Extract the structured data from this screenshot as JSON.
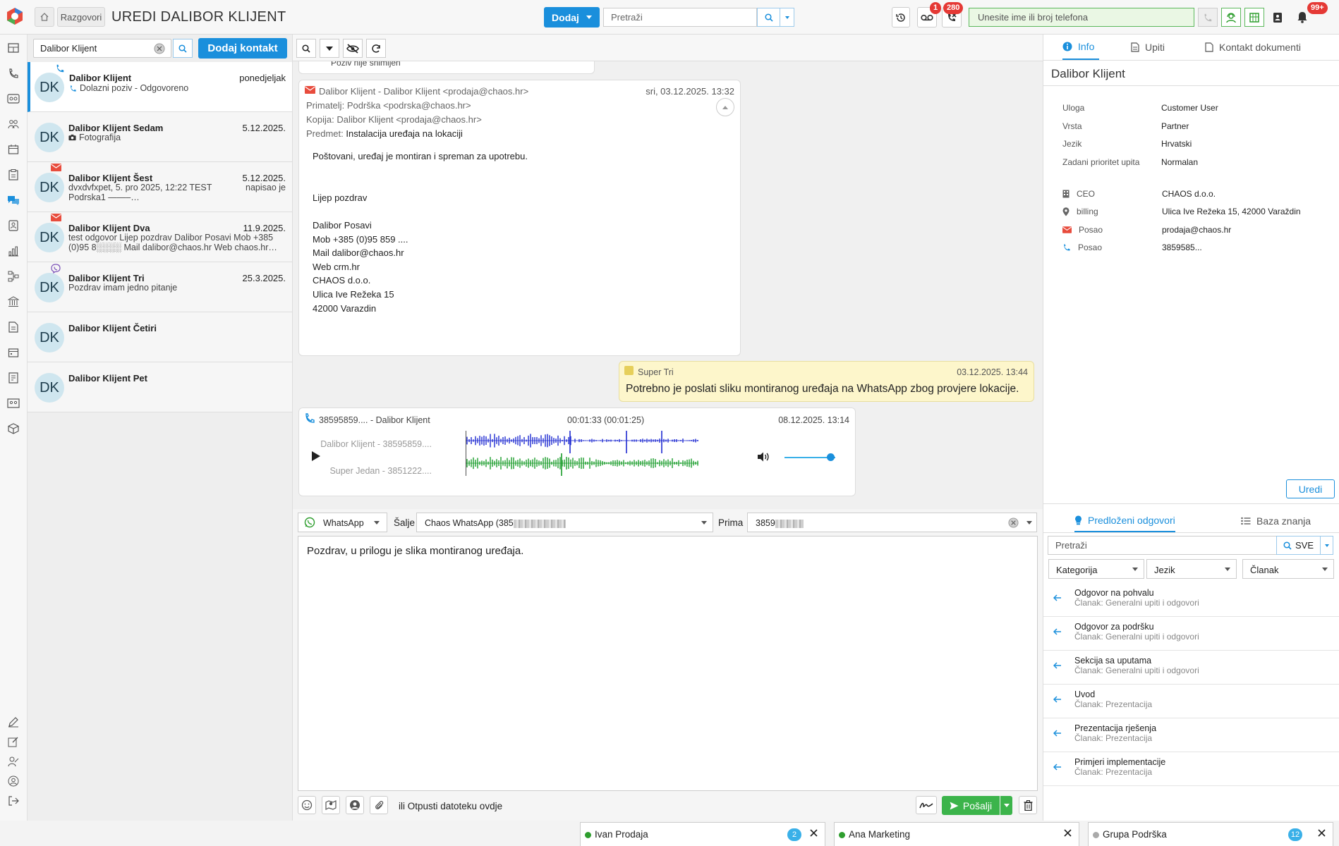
{
  "header": {
    "title": "UREDI DALIBOR KLIJENT",
    "breadcrumb": "Razgovori",
    "add_label": "Dodaj",
    "search_placeholder": "Pretraži",
    "voicemail_badge": "1",
    "missed_badge": "280",
    "phone_placeholder": "Unesite ime ili broj telefona",
    "notifications_badge": "99+"
  },
  "contacts": {
    "search_value": "Dalibor Klijent",
    "add_button": "Dodaj kontakt",
    "items": [
      {
        "initials": "DK",
        "name": "Dalibor Klijent",
        "date": "ponedjeljak",
        "sub": "Dolazni poziv - Odgovoreno",
        "badge": "phone-icon"
      },
      {
        "initials": "DK",
        "name": "Dalibor Klijent Sedam",
        "date": "5.12.2025.",
        "sub": "Fotografija",
        "badge": ""
      },
      {
        "initials": "DK",
        "name": "Dalibor Klijent Šest",
        "date": "5.12.2025.",
        "sub": "dvxdvfxpet, 5. pro 2025, 12:22 TEST Podrska1  ——–…",
        "extra": "napisao je",
        "badge": "email-icon"
      },
      {
        "initials": "DK",
        "name": "Dalibor Klijent Dva",
        "date": "11.9.2025.",
        "sub": "test odgovor Lijep pozdrav Dalibor Posavi Mob +385 (0)95 8░░░░ Mail dalibor@chaos.hr Web chaos.hr…",
        "badge": "email-icon"
      },
      {
        "initials": "DK",
        "name": "Dalibor Klijent Tri",
        "date": "25.3.2025.",
        "sub": "Pozdrav imam jedno pitanje",
        "badge": "viber-icon"
      },
      {
        "initials": "DK",
        "name": "Dalibor Klijent Četiri",
        "date": "",
        "sub": "",
        "badge": ""
      },
      {
        "initials": "DK",
        "name": "Dalibor Klijent Pet",
        "date": "",
        "sub": "",
        "badge": ""
      }
    ]
  },
  "chat": {
    "prev_message_tail": "Poziv nije snimljen",
    "email": {
      "from": "Dalibor Klijent - Dalibor Klijent <prodaja@chaos.hr>",
      "date": "sri, 03.12.2025. 13:32",
      "to_label": "Primatelj:",
      "to": "Podrška <podrska@chaos.hr>",
      "cc_label": "Kopija:",
      "cc": "Dalibor Klijent <prodaja@chaos.hr>",
      "subject_label": "Predmet:",
      "subject": "Instalacija uređaja na lokaciji",
      "body": "Poštovani, uređaj je montiran i spreman za upotrebu.\n\n\nLijep pozdrav\n\nDalibor Posavi\nMob +385 (0)95 859 ....\nMail dalibor@chaos.hr\nWeb crm.hr\nCHAOS d.o.o.\nUlica Ive Režeka 15\n42000 Varazdin"
    },
    "note": {
      "author": "Super Tri",
      "date": "03.12.2025. 13:44",
      "text": "Potrebno je poslati sliku montiranog uređaja na WhatsApp zbog provjere lokacije."
    },
    "call": {
      "title": "38595859.... - Dalibor Klijent",
      "duration": "00:01:33 (00:01:25)",
      "date": "08.12.2025. 13:14",
      "track1": "Dalibor Klijent - 38595859....",
      "track2": "Super Jedan - 3851222....",
      "track1_color": "#1f2bd1",
      "track2_color": "#1a9c2a",
      "volume": 0.9
    }
  },
  "composer": {
    "channel": "WhatsApp",
    "sender_label": "Šalje",
    "sender": "Chaos WhatsApp (385",
    "recipient_label": "Prima",
    "recipient": "3859",
    "message": "Pozdrav, u prilogu je slika montiranog uređaja.",
    "drop_text": "ili Otpusti datoteku ovdje",
    "send_label": "Pošalji"
  },
  "right_panel": {
    "tabs": [
      "Info",
      "Upiti",
      "Kontakt dokumenti"
    ],
    "contact_title": "Dalibor Klijent",
    "info": [
      {
        "label": "Uloga",
        "value": "Customer User"
      },
      {
        "label": "Vrsta",
        "value": "Partner"
      },
      {
        "label": "Jezik",
        "value": "Hrvatski"
      },
      {
        "label": "Zadani prioritet upita",
        "value": "Normalan"
      }
    ],
    "contact_info": [
      {
        "icon": "building-icon",
        "label": "CEO",
        "value": "CHAOS d.o.o."
      },
      {
        "icon": "location-icon",
        "label": "billing",
        "value": "Ulica Ive Režeka 15, 42000 Varaždin"
      },
      {
        "icon": "email-icon",
        "label": "Posao",
        "value": "prodaja@chaos.hr"
      },
      {
        "icon": "phone-icon",
        "label": "Posao",
        "value": "3859585..."
      }
    ],
    "edit_button": "Uredi"
  },
  "suggestions": {
    "tabs": [
      "Predloženi odgovori",
      "Baza znanja"
    ],
    "search_placeholder": "Pretraži",
    "scope": "SVE",
    "filters": [
      "Kategorija",
      "Jezik",
      "Članak"
    ],
    "items": [
      {
        "title": "Odgovor na pohvalu",
        "sub": "Članak: Generalni upiti i odgovori"
      },
      {
        "title": "Odgovor za podršku",
        "sub": "Članak: Generalni upiti i odgovori"
      },
      {
        "title": "Sekcija sa uputama",
        "sub": "Članak: Generalni upiti i odgovori"
      },
      {
        "title": "Uvod",
        "sub": "Članak: Prezentacija"
      },
      {
        "title": "Prezentacija rješenja",
        "sub": "Članak: Prezentacija"
      },
      {
        "title": "Primjeri implementacije",
        "sub": "Članak: Prezentacija"
      }
    ]
  },
  "bottom_tabs": [
    {
      "name": "Ivan Prodaja",
      "count": "2",
      "status_color": "#2e9e2e"
    },
    {
      "name": "Ana Marketing",
      "count": "",
      "status_color": "#2e9e2e"
    },
    {
      "name": "Grupa Podrška",
      "count": "12",
      "status_color": "#aaaaaa"
    }
  ],
  "colors": {
    "accent": "#1a8fdc",
    "send": "#3cb44b",
    "badge": "#e53935",
    "note_bg": "#fdf6cb"
  }
}
